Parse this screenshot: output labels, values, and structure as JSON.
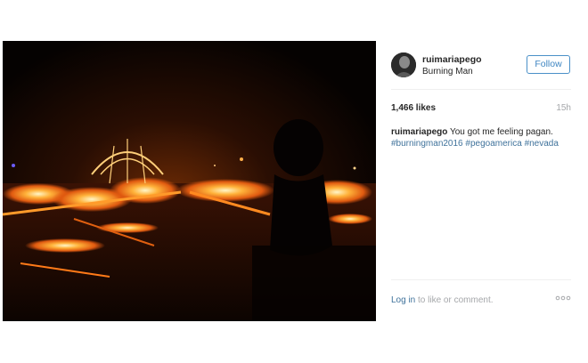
{
  "post": {
    "username": "ruimariapego",
    "location": "Burning Man",
    "follow_label": "Follow",
    "likes": "1,466 likes",
    "time_ago": "15h",
    "caption": {
      "username": "ruimariapego",
      "text": "You got me feeling pagan.",
      "hashtags": [
        "#burningman2016",
        "#pegoamerica",
        "#nevada"
      ]
    },
    "footer": {
      "login_label": "Log in",
      "rest_text": "to like or comment."
    },
    "more_icon": "ellipsis-icon",
    "photo_icon": "bonfire-photo"
  },
  "colors": {
    "link": "#3f729b",
    "follow_border": "#4a90c8",
    "muted": "#a5a7aa",
    "text": "#262626"
  }
}
